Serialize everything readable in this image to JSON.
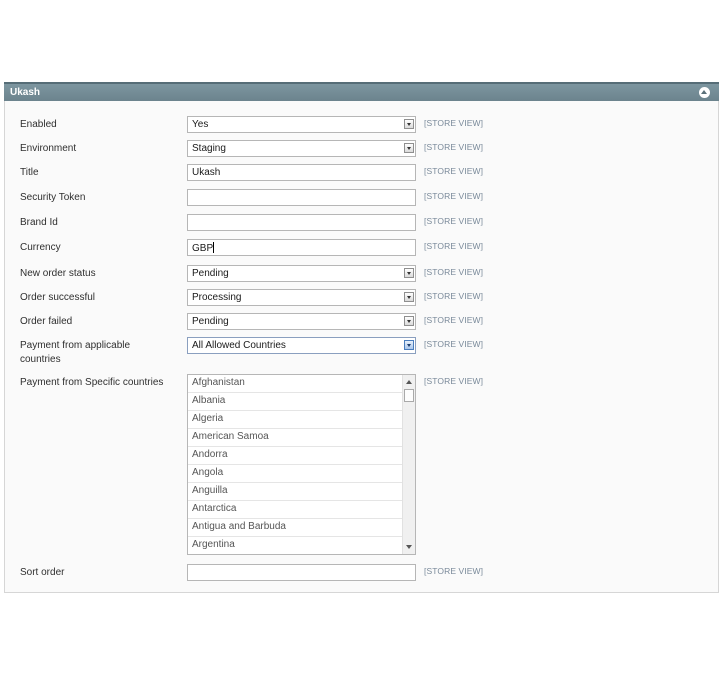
{
  "panel": {
    "title": "Ukash"
  },
  "scope_label": "[STORE VIEW]",
  "fields": {
    "enabled": {
      "label": "Enabled",
      "value": "Yes"
    },
    "environment": {
      "label": "Environment",
      "value": "Staging"
    },
    "title": {
      "label": "Title",
      "value": "Ukash"
    },
    "security_token": {
      "label": "Security Token",
      "value": ""
    },
    "brand_id": {
      "label": "Brand Id",
      "value": ""
    },
    "currency": {
      "label": "Currency",
      "value": "GBP"
    },
    "new_order_status": {
      "label": "New order status",
      "value": "Pending"
    },
    "order_successful": {
      "label": "Order successful",
      "value": "Processing"
    },
    "order_failed": {
      "label": "Order failed",
      "value": "Pending"
    },
    "payment_applicable": {
      "label_line1": "Payment from applicable",
      "label_line2": "countries",
      "value": "All Allowed Countries"
    },
    "payment_specific": {
      "label": "Payment from Specific countries",
      "options": [
        "Afghanistan",
        "Albania",
        "Algeria",
        "American Samoa",
        "Andorra",
        "Angola",
        "Anguilla",
        "Antarctica",
        "Antigua and Barbuda",
        "Argentina"
      ]
    },
    "sort_order": {
      "label": "Sort order",
      "value": ""
    }
  }
}
